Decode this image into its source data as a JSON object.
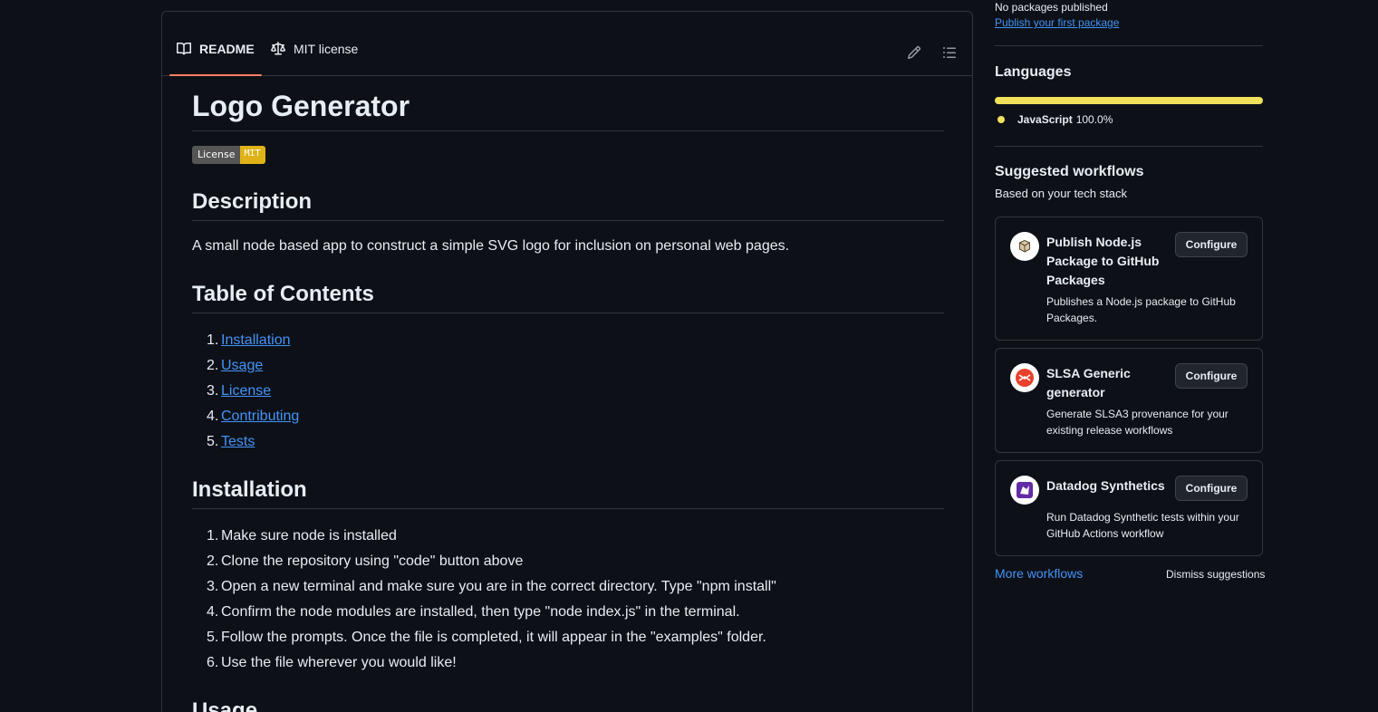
{
  "readme": {
    "tabs": [
      {
        "label": "README",
        "icon": "book-icon",
        "active": true
      },
      {
        "label": "MIT license",
        "icon": "law-icon",
        "active": false
      }
    ],
    "toolbar": {
      "edit_icon": "pencil-icon",
      "toc_icon": "list-unordered-icon"
    },
    "title": "Logo Generator",
    "badge": {
      "left": "License",
      "right": "MIT",
      "color": "#dfb317"
    },
    "description_heading": "Description",
    "description_text": "A small node based app to construct a simple SVG logo for inclusion on personal web pages.",
    "toc_heading": "Table of Contents",
    "toc": [
      {
        "num": "1.",
        "label": "Installation"
      },
      {
        "num": "2.",
        "label": "Usage"
      },
      {
        "num": "3.",
        "label": "License"
      },
      {
        "num": "4.",
        "label": "Contributing"
      },
      {
        "num": "5.",
        "label": "Tests"
      }
    ],
    "installation_heading": "Installation",
    "installation_steps": [
      {
        "num": "1.",
        "text": "Make sure node is installed"
      },
      {
        "num": "2.",
        "text": "Clone the repository using \"code\" button above"
      },
      {
        "num": "3.",
        "text": "Open a new terminal and make sure you are in the correct directory. Type \"npm install\""
      },
      {
        "num": "4.",
        "text": "Confirm the node modules are installed, then type \"node index.js\" in the terminal."
      },
      {
        "num": "5.",
        "text": "Follow the prompts. Once the file is completed, it will appear in the \"examples\" folder."
      },
      {
        "num": "6.",
        "text": "Use the file wherever you would like!"
      }
    ],
    "usage_heading": "Usage"
  },
  "sidebar": {
    "packages": {
      "status": "No packages published",
      "link": "Publish your first package"
    },
    "languages": {
      "heading": "Languages",
      "items": [
        {
          "name": "JavaScript",
          "percent": "100.0%",
          "color": "#f1e05a"
        }
      ]
    },
    "workflows": {
      "heading": "Suggested workflows",
      "subheading": "Based on your tech stack",
      "cards": [
        {
          "title": "Publish Node.js Package to GitHub Packages",
          "desc": "Publishes a Node.js package to GitHub Packages.",
          "button": "Configure",
          "icon": "package-icon"
        },
        {
          "title": "SLSA Generic generator",
          "desc": "Generate SLSA3 provenance for your existing release workflows",
          "button": "Configure",
          "icon": "slsa-icon"
        },
        {
          "title": "Datadog Synthetics",
          "desc": "Run Datadog Synthetic tests within your GitHub Actions workflow",
          "button": "Configure",
          "icon": "datadog-icon"
        }
      ],
      "more_link": "More workflows",
      "dismiss": "Dismiss suggestions"
    }
  }
}
